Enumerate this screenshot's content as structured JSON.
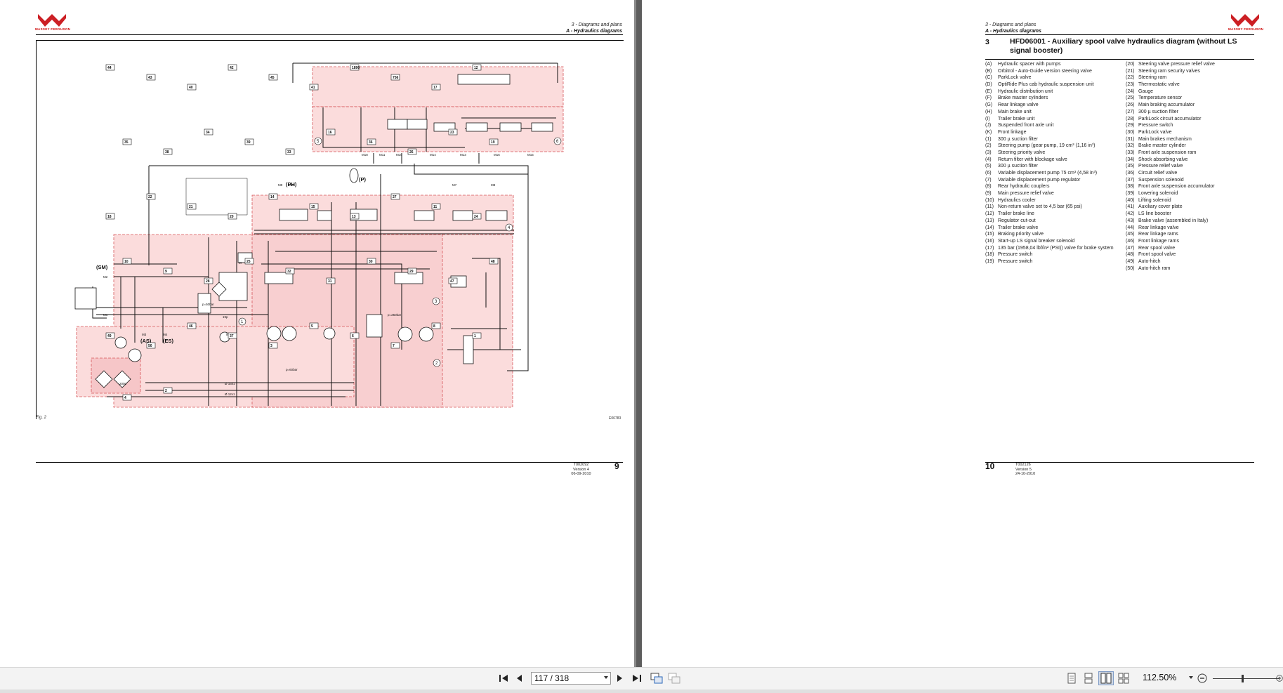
{
  "left_page": {
    "brand": "MASSEY FERGUSON",
    "header_chapter": "3 - Diagrams and plans",
    "header_section": "A - Hydraulics diagrams",
    "fig_label": "Fig. 2",
    "fig_code": "E06783",
    "footer_doc": "T002092",
    "footer_version": "Version 4",
    "footer_date": "06-09-2010",
    "page_number": "9",
    "diagram": {
      "side_labels": [
        "(SM)",
        "(AS)",
        "(ES)",
        "(PH)",
        "(P)"
      ],
      "zone_numbers": [
        "5",
        "6",
        "4",
        "3",
        "1",
        "2"
      ],
      "port_labels": [
        "M18",
        "M11",
        "M10",
        "M14",
        "M13",
        "M16",
        "M15",
        "M9",
        "M22",
        "M7",
        "M8",
        "M2",
        "M1",
        "M3",
        "M4",
        "M5"
      ],
      "block_labels": [
        "44",
        "43",
        "40",
        "42",
        "45",
        "41",
        "1890",
        "756",
        "17",
        "12",
        "35",
        "38",
        "34",
        "39",
        "33",
        "16",
        "36",
        "26",
        "23",
        "19",
        "18",
        "22",
        "21",
        "20",
        "14",
        "15",
        "13",
        "27",
        "11",
        "24",
        "10",
        "9",
        "28",
        "25",
        "32",
        "31",
        "30",
        "29",
        "47",
        "48",
        "49",
        "50",
        "46",
        "37",
        "3",
        "5",
        "6",
        "7",
        "8",
        "1",
        "4",
        "2"
      ],
      "misc_labels": [
        "Ø 16x1",
        "Ø 12x1",
        "p=50bar",
        "p=250bar",
        "p=60bar",
        "19p",
        "200p",
        "M"
      ]
    }
  },
  "right_page": {
    "brand": "MASSEY FERGUSON",
    "header_chapter": "3 - Diagrams and plans",
    "header_section": "A - Hydraulics diagrams",
    "section_number": "3",
    "section_title": "HFD06001 - Auxiliary spool valve hydraulics diagram (without LS signal booster)",
    "legend_left": [
      {
        "key": "(A)",
        "text": "Hydraulic spacer with pumps"
      },
      {
        "key": "(B)",
        "text": "Orbitrol - Auto-Guide version steering valve"
      },
      {
        "key": "(C)",
        "text": "ParkLock valve"
      },
      {
        "key": "(D)",
        "text": "OptiRide Plus cab hydraulic suspension unit"
      },
      {
        "key": "(E)",
        "text": "Hydraulic distribution unit"
      },
      {
        "key": "(F)",
        "text": "Brake master cylinders"
      },
      {
        "key": "(G)",
        "text": "Rear linkage valve"
      },
      {
        "key": "(H)",
        "text": "Main brake unit"
      },
      {
        "key": "(I)",
        "text": "Trailer brake unit"
      },
      {
        "key": "(J)",
        "text": "Suspended front axle unit"
      },
      {
        "key": "(K)",
        "text": "Front linkage"
      },
      {
        "key": "(1)",
        "text": "300 µ suction filter"
      },
      {
        "key": "(2)",
        "text": "Steering pump (gear pump, 19 cm³ (1,16 in³)"
      },
      {
        "key": "(3)",
        "text": "Steering priority valve"
      },
      {
        "key": "(4)",
        "text": "Return filter with blockage valve"
      },
      {
        "key": "(5)",
        "text": "300 µ suction filter"
      },
      {
        "key": "(6)",
        "text": "Variable displacement pump 75 cm³ (4,58 in³)"
      },
      {
        "key": "(7)",
        "text": "Variable displacement pump regulator"
      },
      {
        "key": "(8)",
        "text": "Rear hydraulic couplers"
      },
      {
        "key": "(9)",
        "text": "Main pressure relief valve"
      },
      {
        "key": "(10)",
        "text": "Hydraulics cooler"
      },
      {
        "key": "(11)",
        "text": "Non-return valve set to 4,5 bar (65 psi)"
      },
      {
        "key": "(12)",
        "text": "Trailer brake line"
      },
      {
        "key": "(13)",
        "text": "Regulator cut-out"
      },
      {
        "key": "(14)",
        "text": "Trailer brake valve"
      },
      {
        "key": "(15)",
        "text": "Braking priority valve"
      },
      {
        "key": "(16)",
        "text": "Start-up LS signal breaker solenoid"
      },
      {
        "key": "(17)",
        "text": "135 bar (1958,04 lbf/in² (PSI)) valve for brake system"
      },
      {
        "key": "(18)",
        "text": "Pressure switch"
      },
      {
        "key": "(19)",
        "text": "Pressure switch"
      }
    ],
    "legend_right": [
      {
        "key": "(20)",
        "text": "Steering valve pressure relief valve"
      },
      {
        "key": "(21)",
        "text": "Steering ram security valves"
      },
      {
        "key": "(22)",
        "text": "Steering ram"
      },
      {
        "key": "(23)",
        "text": "Thermostatic valve"
      },
      {
        "key": "(24)",
        "text": "Gauge"
      },
      {
        "key": "(25)",
        "text": "Temperature sensor"
      },
      {
        "key": "(26)",
        "text": "Main braking accumulator"
      },
      {
        "key": "(27)",
        "text": "300 µ suction filter"
      },
      {
        "key": "(28)",
        "text": "ParkLock circuit accumulator"
      },
      {
        "key": "(29)",
        "text": "Pressure switch"
      },
      {
        "key": "(30)",
        "text": "ParkLock valve"
      },
      {
        "key": "(31)",
        "text": "Main brakes mechanism"
      },
      {
        "key": "(32)",
        "text": "Brake master cylinder"
      },
      {
        "key": "(33)",
        "text": "Front axle suspension ram"
      },
      {
        "key": "(34)",
        "text": "Shock absorbing valve"
      },
      {
        "key": "(35)",
        "text": "Pressure relief valve"
      },
      {
        "key": "(36)",
        "text": "Circuit relief valve"
      },
      {
        "key": "(37)",
        "text": "Suspension solenoid"
      },
      {
        "key": "(38)",
        "text": "Front axle suspension accumulator"
      },
      {
        "key": "(39)",
        "text": "Lowering solenoid"
      },
      {
        "key": "(40)",
        "text": "Lifting solenoid"
      },
      {
        "key": "(41)",
        "text": "Auxiliary cover plate"
      },
      {
        "key": "(42)",
        "text": "LS line booster"
      },
      {
        "key": "(43)",
        "text": "Brake valve (assembled in Italy)"
      },
      {
        "key": "(44)",
        "text": "Rear linkage valve"
      },
      {
        "key": "(45)",
        "text": "Rear linkage rams"
      },
      {
        "key": "(46)",
        "text": "Front linkage rams"
      },
      {
        "key": "(47)",
        "text": "Rear spool valve"
      },
      {
        "key": "(48)",
        "text": "Front spool valve"
      },
      {
        "key": "(49)",
        "text": "Auto-hitch"
      },
      {
        "key": "(50)",
        "text": "Auto-hitch ram"
      }
    ],
    "footer_doc": "T002126",
    "footer_version": "Version 5",
    "footer_date": "24-10-2010",
    "page_number": "10"
  },
  "toolbar": {
    "page_indicator": "117 / 318",
    "zoom_level": "112.50%",
    "zoom_slider_fraction": 0.45,
    "icons": [
      "first-page-icon",
      "previous-page-icon",
      "next-page-icon",
      "last-page-icon",
      "fit-page-icon",
      "fit-width-icon",
      "single-page-view-icon",
      "continuous-view-icon",
      "two-page-view-icon",
      "two-page-continuous-view-icon",
      "zoom-out-icon",
      "zoom-in-icon"
    ]
  },
  "colors": {
    "logo_red": "#cc1f24",
    "zone_fill": "#fbdcdc",
    "zone_border": "#d6565a",
    "gutter": "#5d5d5d",
    "toolbar_bg": "#f3f3f3",
    "active_view_button": "#cfd8e6"
  }
}
